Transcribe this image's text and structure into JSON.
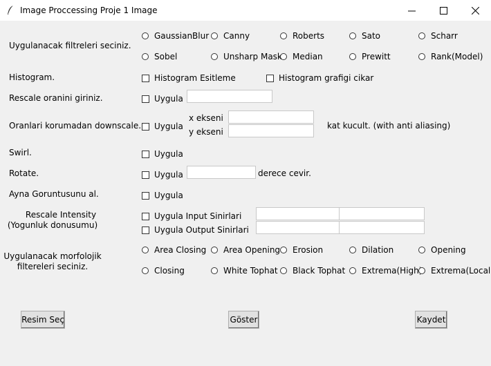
{
  "window": {
    "title": "Image Proccessing Proje 1 Image",
    "icon": "feather-icon"
  },
  "filters": {
    "label": "Uygulanacak filtreleri seciniz.",
    "options": [
      "GaussianBlur",
      "Canny",
      "Roberts",
      "Sato",
      "Scharr",
      "Sobel",
      "Unsharp Mask",
      "Median",
      "Prewitt",
      "Rank(Model)"
    ]
  },
  "histogram": {
    "label": "Histogram.",
    "equalize": "Histogram Esitleme",
    "plot": "Histogram grafigi cikar"
  },
  "rescale": {
    "label": "Rescale oranini giriniz.",
    "apply": "Uygula",
    "value": ""
  },
  "downscale": {
    "label": "Oranlari korumadan downscale.",
    "apply": "Uygula",
    "x_label": "x ekseni",
    "y_label": "y ekseni",
    "x_value": "",
    "y_value": "",
    "suffix": "kat kucult. (with anti aliasing)"
  },
  "swirl": {
    "label": "Swirl.",
    "apply": "Uygula"
  },
  "rotate": {
    "label": "Rotate.",
    "apply": "Uygula",
    "value": "",
    "suffix": "derece cevir."
  },
  "mirror": {
    "label": "Ayna Goruntusunu al.",
    "apply": "Uygula"
  },
  "intensity": {
    "label_line1": "Rescale Intensity",
    "label_line2": "(Yogunluk donusumu)",
    "input_label": "Uygula Input Sinirlari",
    "output_label": "Uygula Output Sinirlari",
    "input_min": "",
    "input_max": "",
    "output_min": "",
    "output_max": ""
  },
  "morphology": {
    "label_line1": "Uygulanacak morfolojik",
    "label_line2": "filtereleri seciniz.",
    "options": [
      "Area Closing",
      "Area Opening",
      "Erosion",
      "Dilation",
      "Opening",
      "Closing",
      "White Tophat",
      "Black Tophat",
      "Extrema(High)",
      "Extrema(Local)"
    ]
  },
  "buttons": {
    "select": "Resim Seç",
    "show": "Göster",
    "save": "Kaydet"
  }
}
